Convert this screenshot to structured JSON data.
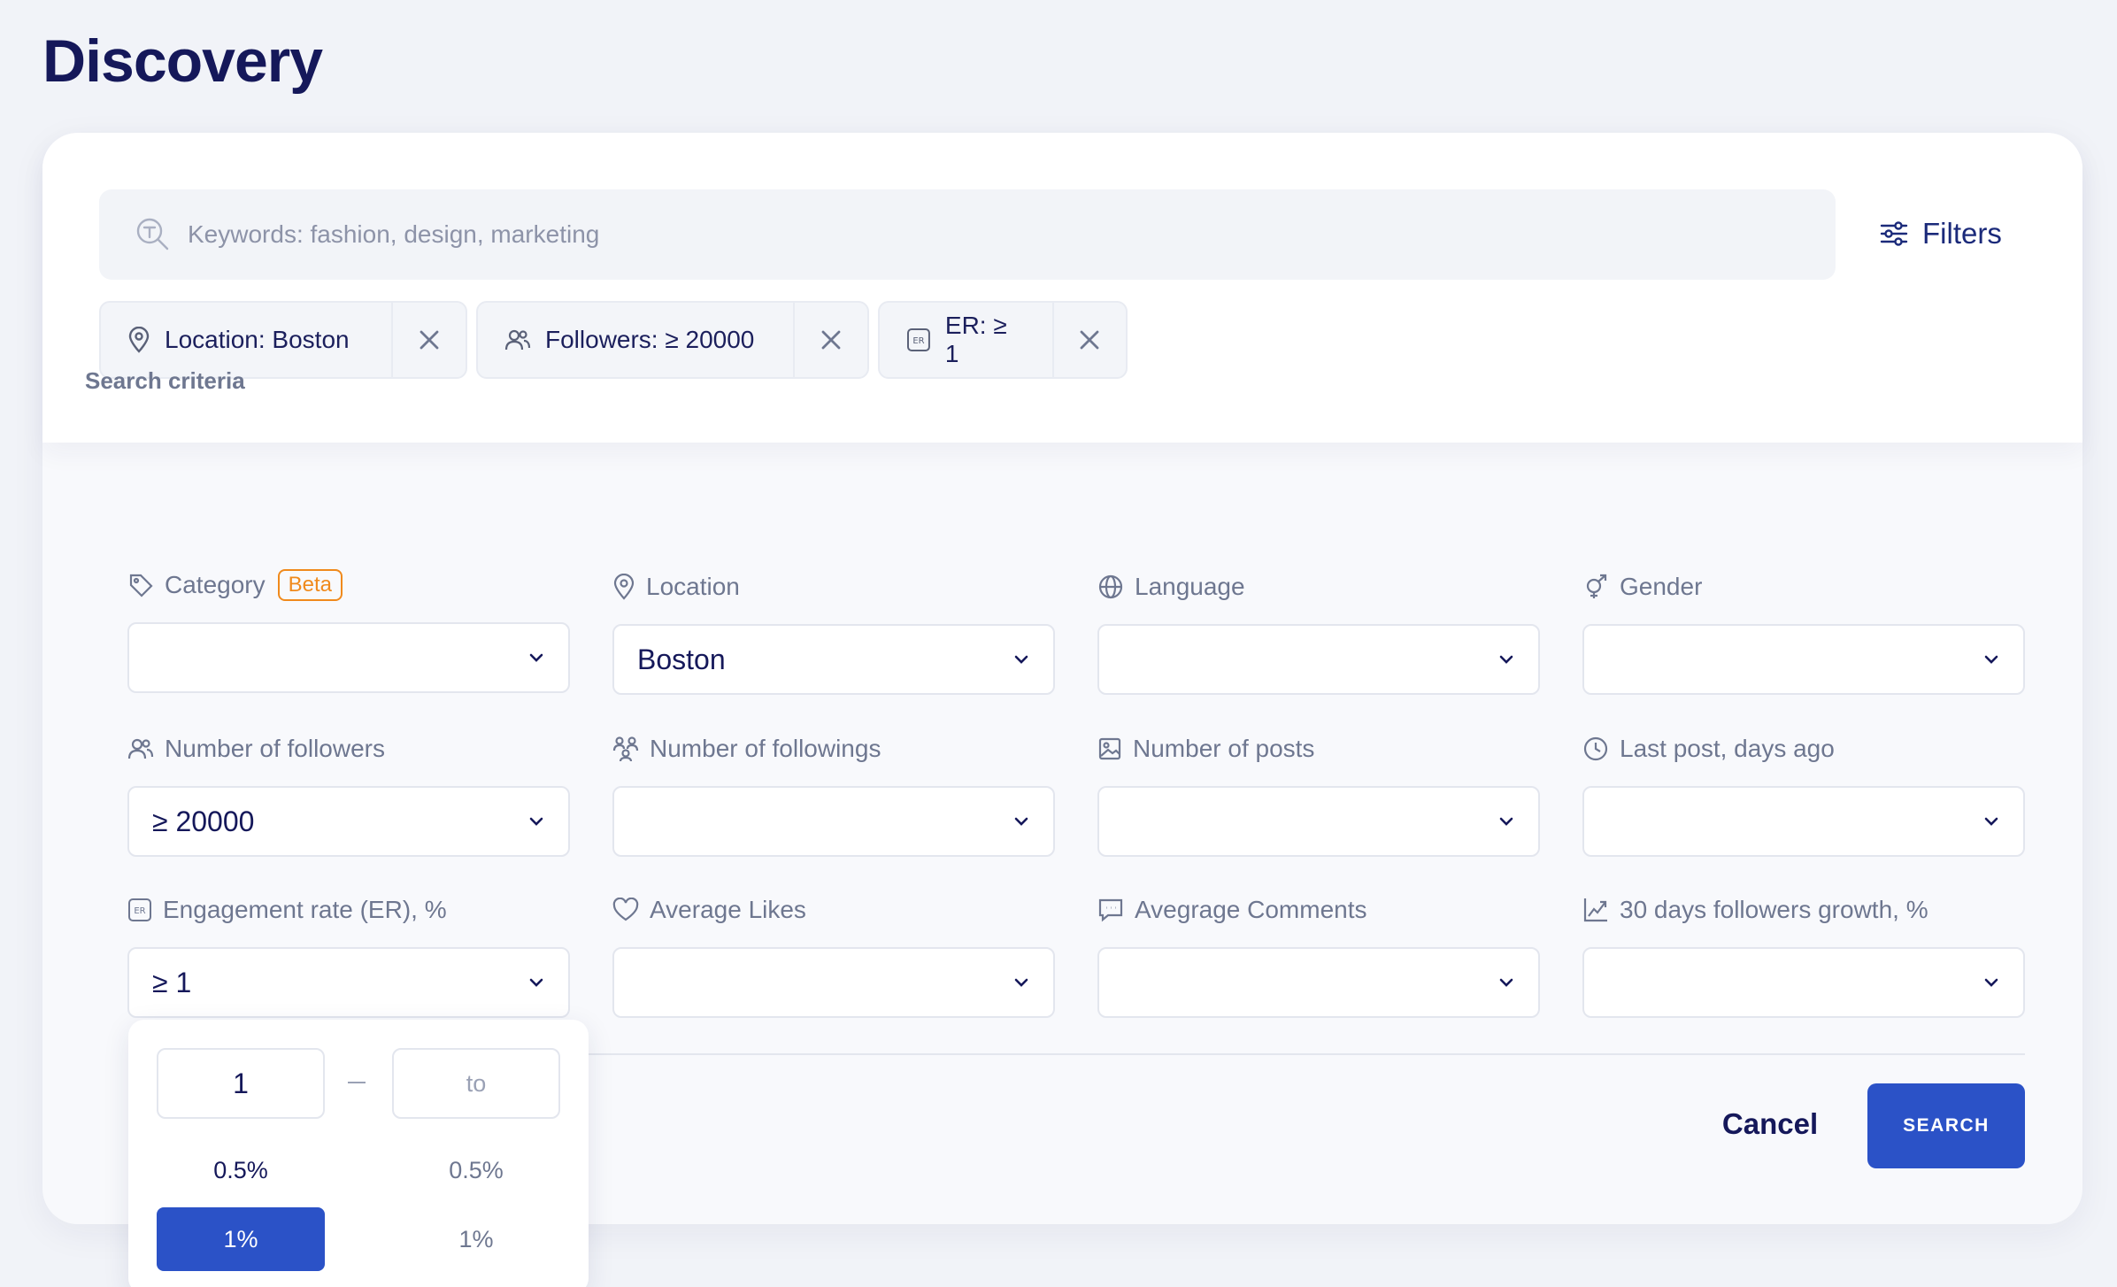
{
  "page": {
    "title": "Discovery"
  },
  "search": {
    "placeholder": "Keywords: fashion, design, marketing",
    "value": ""
  },
  "filters_button": {
    "label": "Filters"
  },
  "chips": [
    {
      "label": "Location: Boston",
      "icon": "pin-icon"
    },
    {
      "label": "Followers: ≥ 20000",
      "icon": "users-icon"
    },
    {
      "label": "ER: ≥ 1",
      "icon": "er-icon"
    }
  ],
  "criteria": {
    "title": "Search criteria",
    "fields": [
      {
        "label": "Category",
        "badge": "Beta",
        "value": "",
        "icon": "tag-icon"
      },
      {
        "label": "Location",
        "value": "Boston",
        "icon": "pin-icon"
      },
      {
        "label": "Language",
        "value": "",
        "icon": "globe-icon"
      },
      {
        "label": "Gender",
        "value": "",
        "icon": "gender-icon"
      },
      {
        "label": "Number of followers",
        "value": "≥ 20000",
        "icon": "users-icon"
      },
      {
        "label": "Number of followings",
        "value": "",
        "icon": "followings-icon"
      },
      {
        "label": "Number of posts",
        "value": "",
        "icon": "image-icon"
      },
      {
        "label": "Last post, days ago",
        "value": "",
        "icon": "clock-icon"
      },
      {
        "label": "Engagement rate (ER), %",
        "value": "≥ 1",
        "icon": "er-icon"
      },
      {
        "label": "Average Likes",
        "value": "",
        "icon": "heart-icon"
      },
      {
        "label": "Avegrage Comments",
        "value": "",
        "icon": "comment-icon"
      },
      {
        "label": "30 days followers growth, %",
        "value": "",
        "icon": "growth-icon"
      }
    ]
  },
  "er_dropdown": {
    "from_value": "1",
    "to_placeholder": "to",
    "from_options": [
      "0.5%",
      "1%"
    ],
    "to_options": [
      "0.5%",
      "1%"
    ],
    "selected_from": "1%"
  },
  "actions": {
    "cancel": "Cancel",
    "search": "SEARCH"
  },
  "colors": {
    "accent": "#2b52c7",
    "title": "#15185a",
    "badge": "#f08a1c"
  }
}
